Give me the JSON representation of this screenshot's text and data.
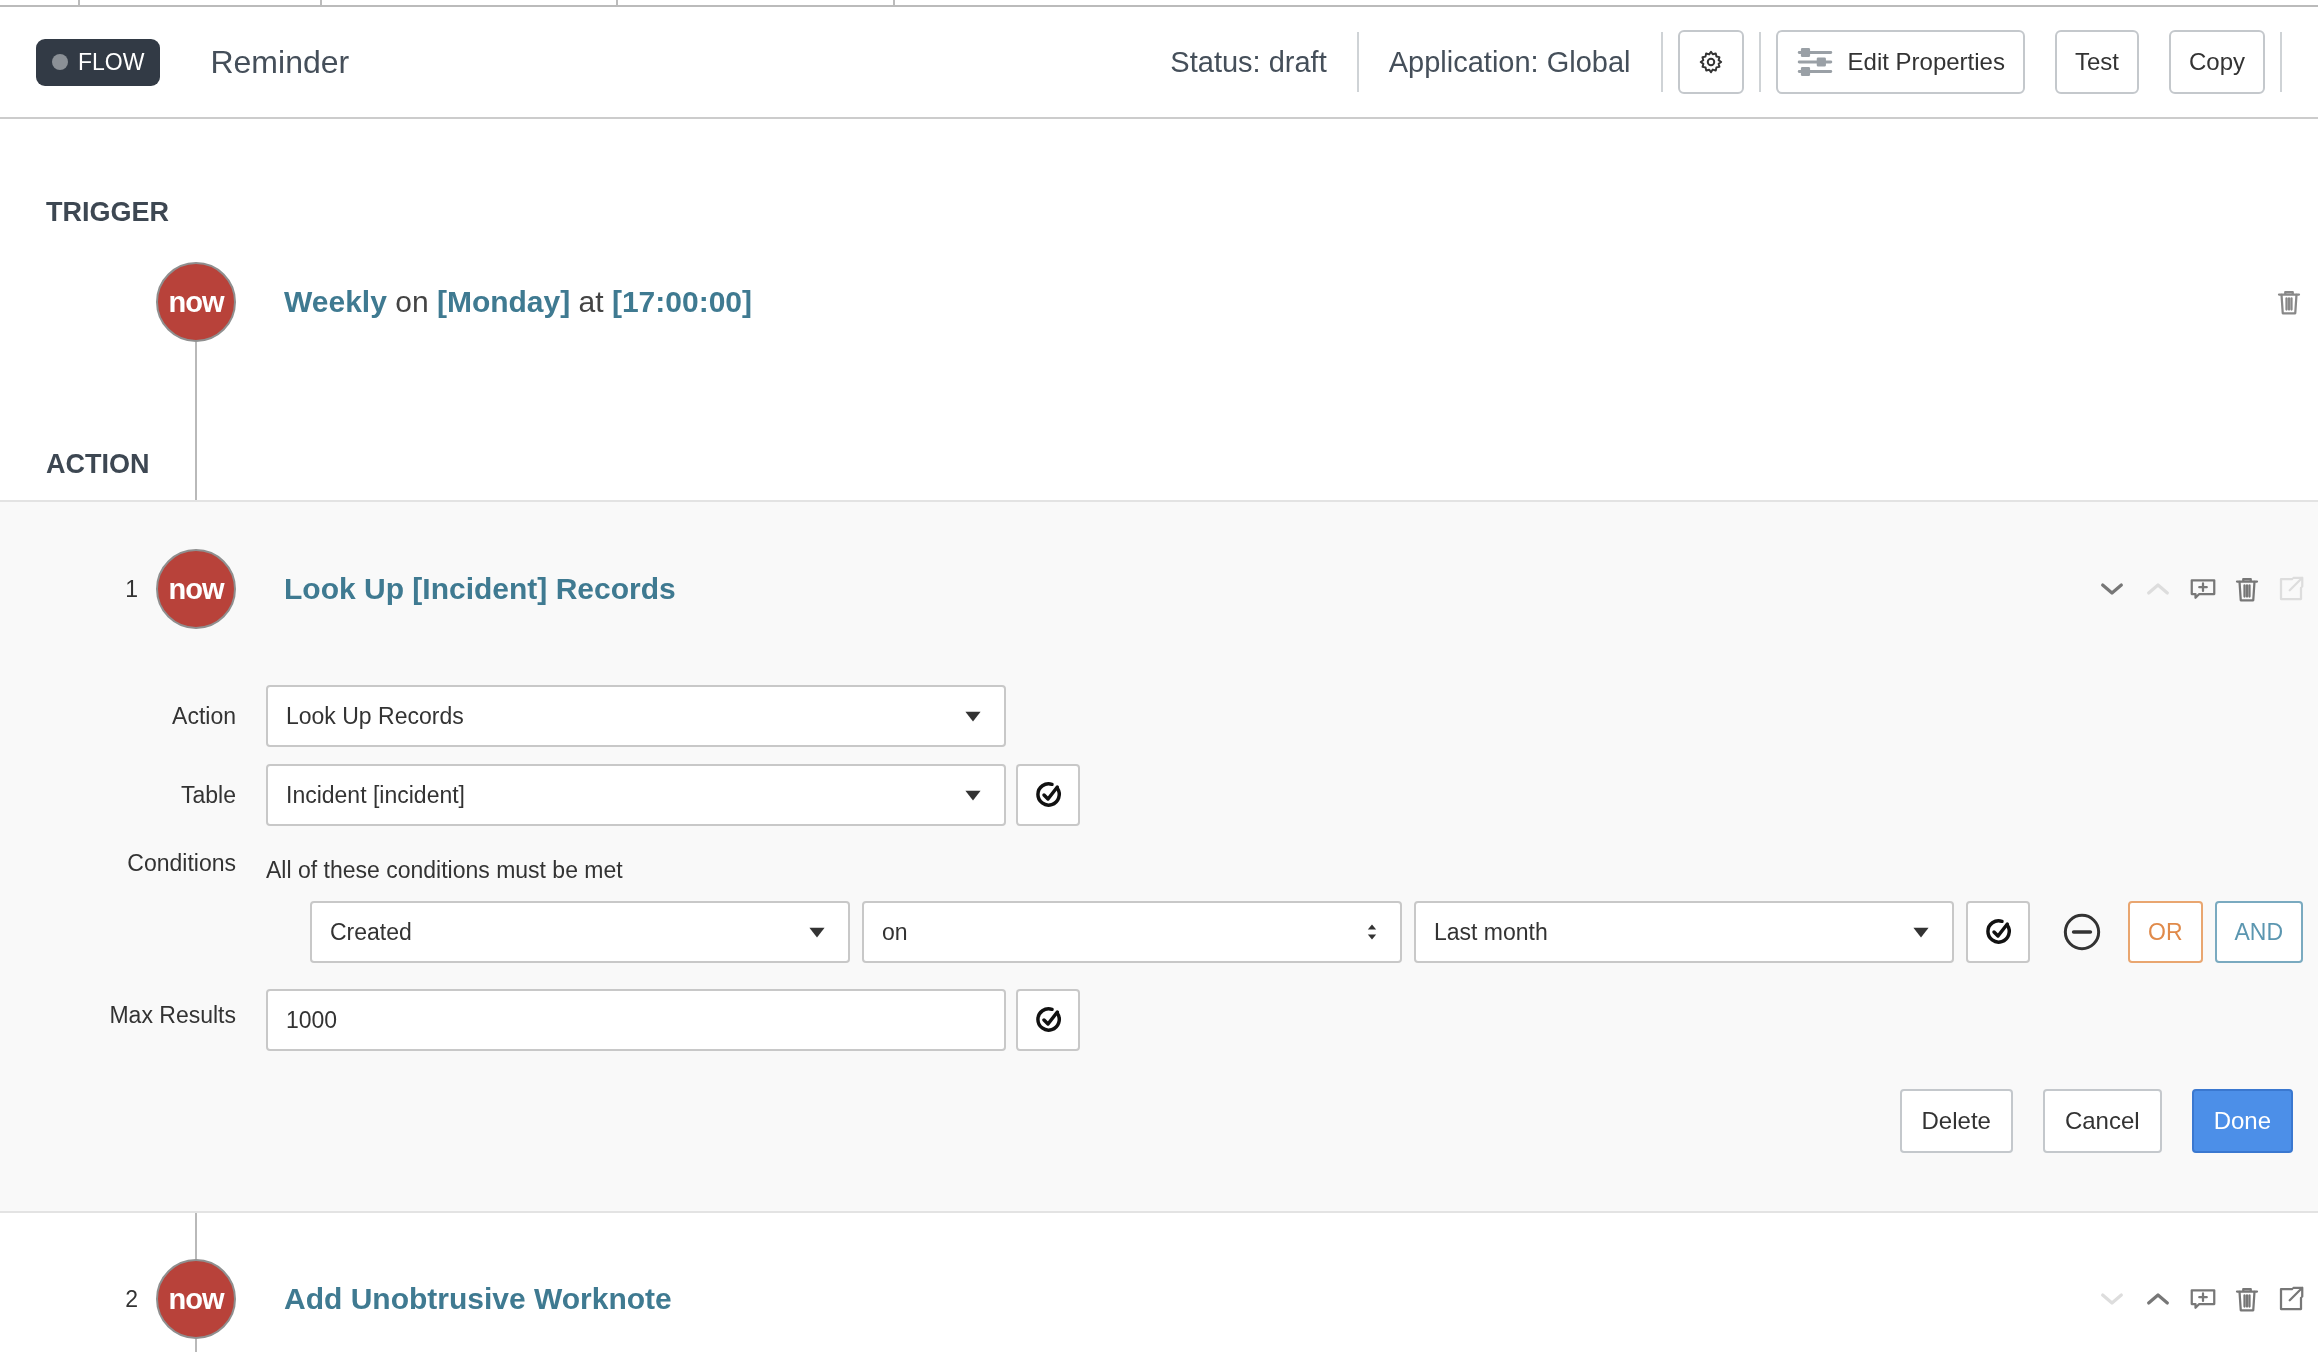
{
  "header": {
    "badge": "FLOW",
    "title": "Reminder",
    "status": "Status: draft",
    "application": "Application: Global",
    "buttons": [
      {
        "kind": "settings"
      },
      {
        "kind": "edit",
        "label": "Edit Properties"
      },
      {
        "kind": "plain",
        "label": "Test"
      },
      {
        "kind": "plain",
        "label": "Copy"
      }
    ]
  },
  "trigger": {
    "heading": "TRIGGER",
    "logo": "now",
    "sentence": "**Weekly** on **[Monday]** at **[17:00:00]**"
  },
  "action_heading": "ACTION",
  "steps": [
    {
      "number": "1",
      "logo": "now",
      "title": "Look Up [Incident] Records",
      "expanded": true,
      "controls": [
        {
          "kind": "move-down",
          "disabled": false
        },
        {
          "kind": "move-up",
          "disabled": true
        },
        {
          "kind": "comment",
          "disabled": false
        },
        {
          "kind": "delete",
          "disabled": false
        },
        {
          "kind": "open",
          "disabled": true
        }
      ],
      "fields": [
        {
          "kind": "select",
          "label": "Action",
          "value": "Look Up Records",
          "pill": false
        },
        {
          "kind": "select",
          "label": "Table",
          "value": "Incident [incident]",
          "pill": true
        },
        {
          "kind": "conditions",
          "label": "Conditions",
          "text": "All of these conditions must be met",
          "rows": [
            {
              "field": "Created",
              "operator": "on",
              "value": "Last month",
              "or_label": "OR",
              "and_label": "AND"
            }
          ]
        },
        {
          "kind": "text",
          "label": "Max Results",
          "value": "1000",
          "pill": true
        }
      ],
      "buttons": [
        {
          "kind": "secondary",
          "label": "Delete"
        },
        {
          "kind": "secondary",
          "label": "Cancel"
        },
        {
          "kind": "primary",
          "label": "Done"
        }
      ]
    },
    {
      "number": "2",
      "logo": "now",
      "title": "Add Unobtrusive Worknote",
      "expanded": false,
      "controls": [
        {
          "kind": "move-down",
          "disabled": true
        },
        {
          "kind": "move-up",
          "disabled": false
        },
        {
          "kind": "comment",
          "disabled": false
        },
        {
          "kind": "delete",
          "disabled": false
        },
        {
          "kind": "open",
          "disabled": false
        }
      ]
    }
  ]
}
